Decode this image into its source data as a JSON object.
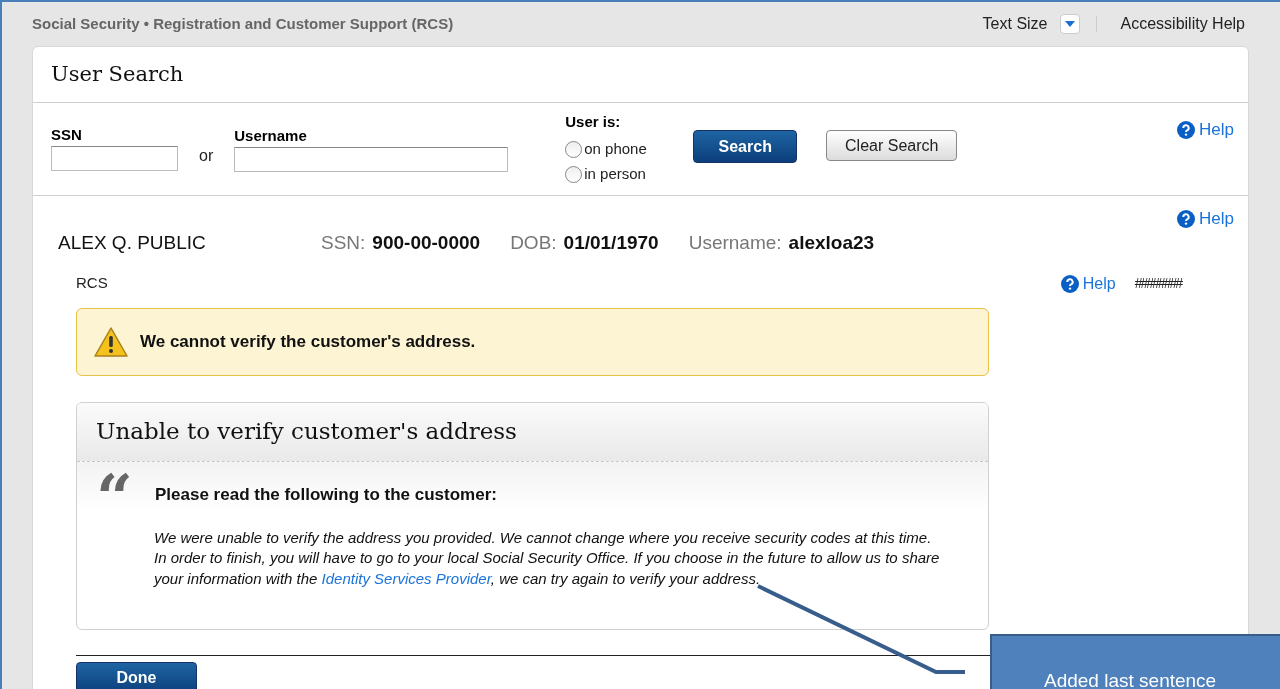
{
  "header": {
    "title": "Social Security • Registration and Customer Support (RCS)",
    "text_size": "Text Size",
    "accessibility": "Accessibility Help"
  },
  "card_title": "User Search",
  "search": {
    "ssn_label": "SSN",
    "or": "or",
    "username_label": "Username",
    "user_is": "User is:",
    "radios": [
      {
        "label": "on phone",
        "selected": false
      },
      {
        "label": "in person",
        "selected": false
      }
    ],
    "search_button": "Search",
    "clear_button": "Clear Search",
    "help": "Help"
  },
  "customer": {
    "help": "Help",
    "name": "ALEX Q. PUBLIC",
    "fields": [
      {
        "label": "SSN:",
        "value": "900-00-0000"
      },
      {
        "label": "DOB:",
        "value": "01/01/1970"
      },
      {
        "label": "Username:",
        "value": "alexloa23"
      }
    ]
  },
  "rcs": {
    "label": "RCS",
    "help": "Help",
    "code": "########"
  },
  "warning": "We cannot verify the customer's address.",
  "panel": {
    "title": "Unable to verify customer's address",
    "quote_mark": "“",
    "heading": "Please read the following to the customer:",
    "text_before": "We were unable to verify the address you provided. We cannot change where you receive security codes at this time. In order to finish, you will have to go to your local Social Security Office. If you choose in the future to allow us to share your information with the ",
    "link": "Identity Services Provider",
    "text_after": ", we can try again to verify your address."
  },
  "done_button": "Done",
  "callout": "Added last sentence"
}
